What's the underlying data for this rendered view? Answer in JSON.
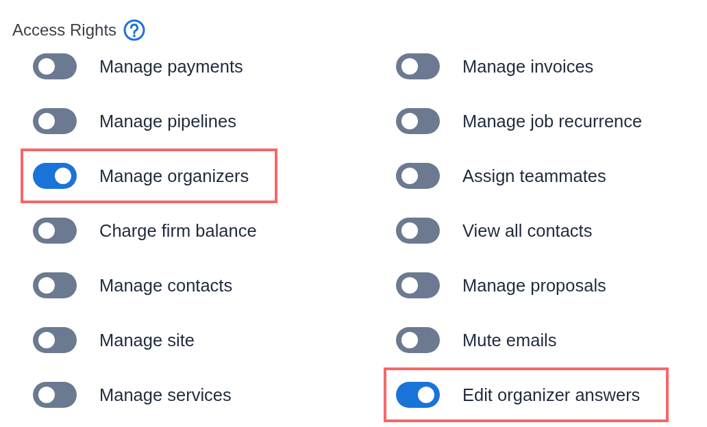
{
  "section": {
    "title": "Access Rights"
  },
  "permissions": [
    {
      "label": "Manage payments",
      "on": false,
      "highlighted": false
    },
    {
      "label": "Manage invoices",
      "on": false,
      "highlighted": false
    },
    {
      "label": "Manage pipelines",
      "on": false,
      "highlighted": false
    },
    {
      "label": "Manage job recurrence",
      "on": false,
      "highlighted": false
    },
    {
      "label": "Manage organizers",
      "on": true,
      "highlighted": true
    },
    {
      "label": "Assign teammates",
      "on": false,
      "highlighted": false
    },
    {
      "label": "Charge firm balance",
      "on": false,
      "highlighted": false
    },
    {
      "label": "View all contacts",
      "on": false,
      "highlighted": false
    },
    {
      "label": "Manage contacts",
      "on": false,
      "highlighted": false
    },
    {
      "label": "Manage proposals",
      "on": false,
      "highlighted": false
    },
    {
      "label": "Manage site",
      "on": false,
      "highlighted": false
    },
    {
      "label": "Mute emails",
      "on": false,
      "highlighted": false
    },
    {
      "label": "Manage services",
      "on": false,
      "highlighted": false
    },
    {
      "label": "Edit organizer answers",
      "on": true,
      "highlighted": true
    }
  ]
}
